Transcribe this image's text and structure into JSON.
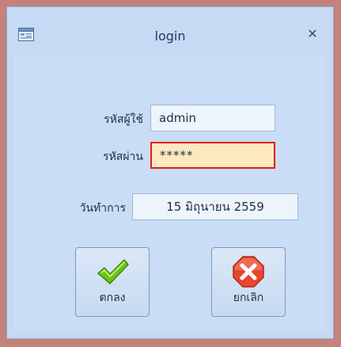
{
  "window": {
    "title": "login",
    "close_glyph": "✕"
  },
  "form": {
    "username_label": "รหัสผู้ใช้",
    "username_value": "admin",
    "password_label": "รหัสผ่าน",
    "password_value": "*****",
    "workdate_label": "วันทำการ",
    "workdate_value": "15 มิถุนายน 2559"
  },
  "buttons": {
    "ok_label": "ตกลง",
    "ok_icon": "checkmark-icon",
    "cancel_label": "ยกเลิก",
    "cancel_icon": "cancel-x-icon"
  },
  "colors": {
    "window_bg": "#c9ddf6",
    "password_border": "#e31b1b",
    "password_bg": "#fde8bf",
    "check_green": "#6cc21b",
    "cancel_red": "#e8452c"
  }
}
